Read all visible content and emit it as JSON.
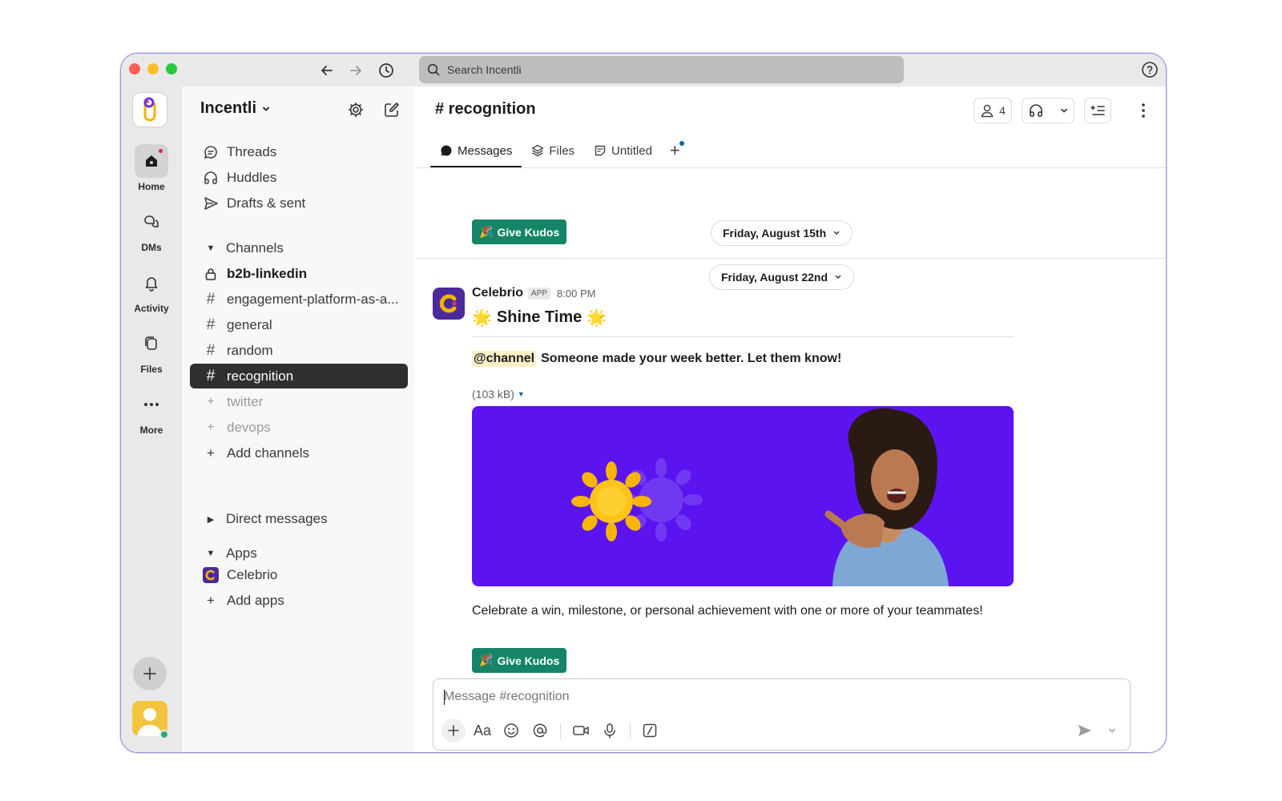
{
  "titlebar": {
    "search_placeholder": "Search Incentli"
  },
  "rail": {
    "items": [
      {
        "label": "Home",
        "icon": "home-icon",
        "active": true,
        "notification": true
      },
      {
        "label": "DMs",
        "icon": "dms-icon"
      },
      {
        "label": "Activity",
        "icon": "bell-icon"
      },
      {
        "label": "Files",
        "icon": "files-icon"
      },
      {
        "label": "More",
        "icon": "more-icon"
      }
    ]
  },
  "sidebar": {
    "workspace_name": "Incentli",
    "nav": [
      {
        "label": "Threads",
        "icon": "threads-icon"
      },
      {
        "label": "Huddles",
        "icon": "headphones-icon"
      },
      {
        "label": "Drafts & sent",
        "icon": "send-icon"
      }
    ],
    "channels_header": "Channels",
    "channels": [
      {
        "label": "b2b-linkedin",
        "icon": "lock-icon",
        "style": "bold"
      },
      {
        "label": "engagement-platform-as-a...",
        "icon": "hash-icon"
      },
      {
        "label": "general",
        "icon": "hash-icon"
      },
      {
        "label": "random",
        "icon": "hash-icon"
      },
      {
        "label": "recognition",
        "icon": "hash-icon",
        "style": "active"
      },
      {
        "label": "twitter",
        "icon": "plus-icon",
        "style": "muted"
      },
      {
        "label": "devops",
        "icon": "plus-icon",
        "style": "muted"
      },
      {
        "label": "Add channels",
        "icon": "plus-icon"
      }
    ],
    "dm_header": "Direct messages",
    "apps_header": "Apps",
    "apps": [
      {
        "label": "Celebrio",
        "icon": "celebrio-logo-icon"
      },
      {
        "label": "Add apps",
        "icon": "plus-icon"
      }
    ]
  },
  "channel": {
    "title": "# recognition",
    "member_count": "4",
    "tabs": [
      {
        "label": "Messages",
        "icon": "message-icon",
        "active": true
      },
      {
        "label": "Files",
        "icon": "layers-icon"
      },
      {
        "label": "Untitled",
        "icon": "canvas-icon"
      }
    ]
  },
  "messages": {
    "kudos_label": "Give Kudos",
    "date_1": "Friday, August 15th",
    "date_2": "Friday, August 22nd",
    "author": "Celebrio",
    "app_badge": "APP",
    "time": "8:00 PM",
    "heading": "Shine Time",
    "mention": "@channel",
    "body": "Someone made your week better. Let them know!",
    "file_size": "(103 kB)",
    "celebrate_text": "Celebrate a win, milestone, or personal achievement with one or more of your teammates!"
  },
  "composer": {
    "placeholder": "Message #recognition"
  },
  "colors": {
    "kudos_green": "#148567",
    "banner_purple": "#5b14f0",
    "active_channel": "#2f2f30",
    "mention_bg": "#fbefc6"
  }
}
